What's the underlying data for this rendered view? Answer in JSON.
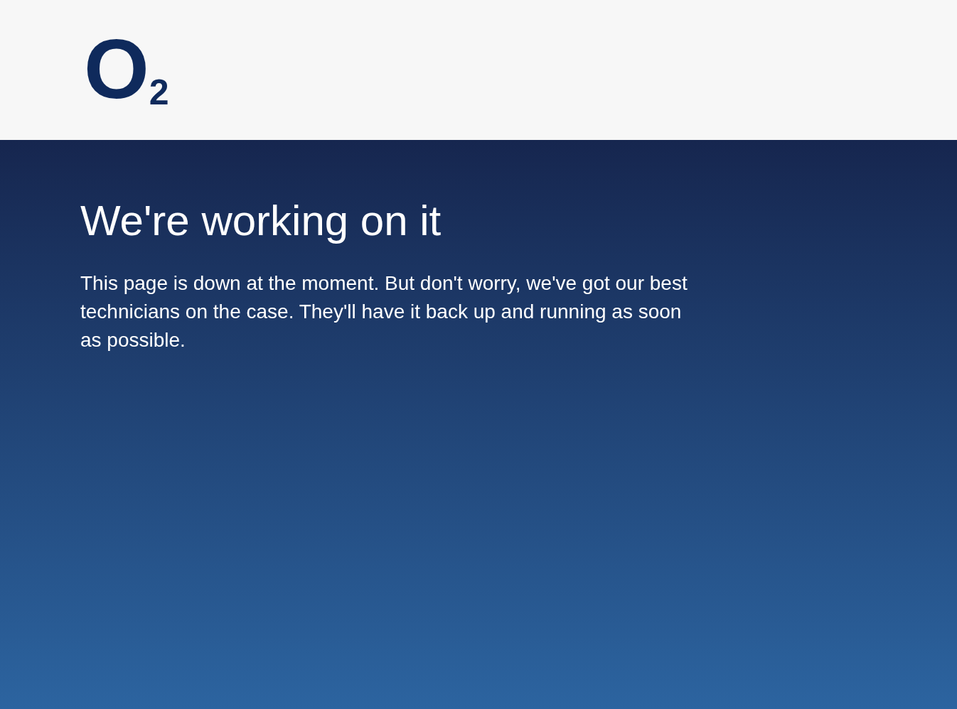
{
  "header": {
    "logo": {
      "letter": "O",
      "subscript": "2"
    }
  },
  "main": {
    "heading": "We're working on it",
    "message": "This page is down at the moment. But don't worry, we've got our best technicians on the case. They'll have it back up and running as soon as possible."
  }
}
